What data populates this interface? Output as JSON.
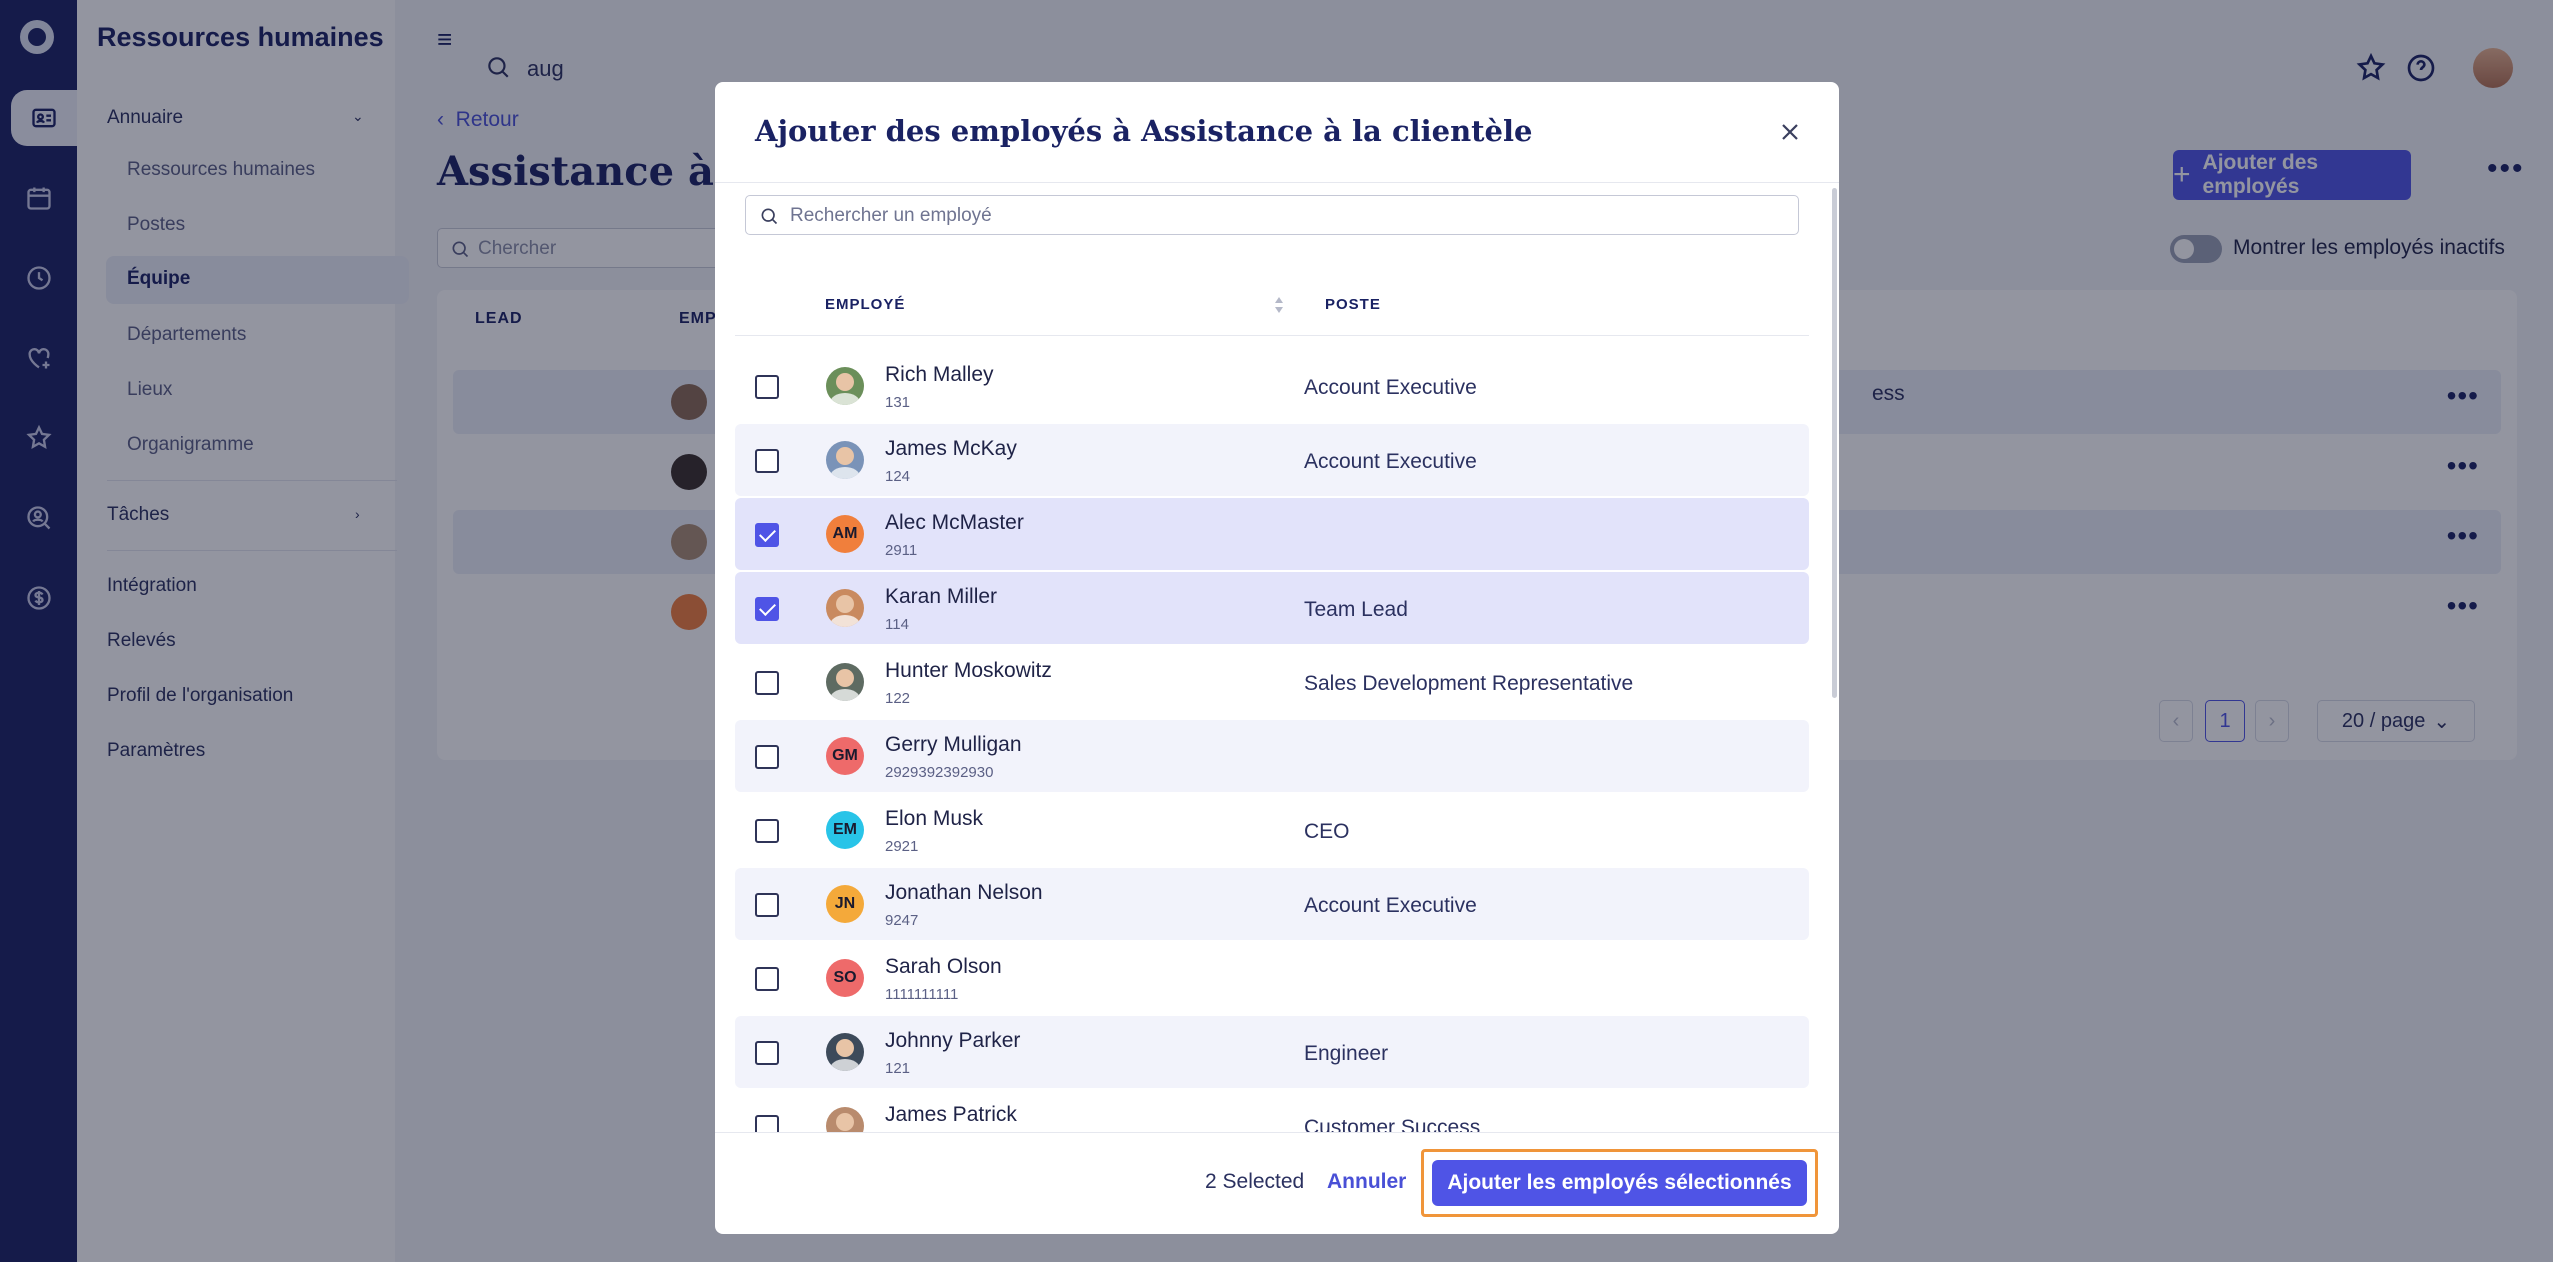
{
  "app": {
    "title": "Ressources humaines"
  },
  "rail": {
    "items": [
      {
        "icon": "contact-card-icon",
        "active": true
      },
      {
        "icon": "calendar-icon",
        "active": false
      },
      {
        "icon": "clock-icon",
        "active": false
      },
      {
        "icon": "heart-plus-icon",
        "active": false
      },
      {
        "icon": "star-plus-icon",
        "active": false
      },
      {
        "icon": "person-search-icon",
        "active": false
      },
      {
        "icon": "dollar-icon",
        "active": false
      }
    ]
  },
  "sidebar": {
    "sections": [
      {
        "label": "Annuaire"
      },
      {
        "label": "Tâches"
      },
      {
        "label": "Intégration"
      },
      {
        "label": "Relevés"
      },
      {
        "label": "Profil de l'organisation"
      },
      {
        "label": "Paramètres"
      }
    ],
    "annuaire_items": [
      {
        "label": "Ressources humaines"
      },
      {
        "label": "Postes"
      },
      {
        "label": "Équipe"
      },
      {
        "label": "Départements"
      },
      {
        "label": "Lieux"
      },
      {
        "label": "Organigramme"
      }
    ]
  },
  "header": {
    "search_value": "aug"
  },
  "page": {
    "back_label": "Retour",
    "title": "Assistance à la",
    "add_button": "Ajouter des employés",
    "search_placeholder": "Chercher",
    "toggle_label": "Montrer les employés inactifs",
    "table_headers": {
      "lead": "LEAD",
      "employee": "EMP"
    },
    "partial_cell": "ess",
    "current_page": "1",
    "page_size": "20 / page"
  },
  "modal": {
    "title": "Ajouter des employés à Assistance à la clientèle",
    "search_placeholder": "Rechercher un employé",
    "col_employee": "EMPLOYÉ",
    "col_position": "POSTE",
    "employees": [
      {
        "name": "Rich Malley",
        "id": "131",
        "position": "Account Executive",
        "checked": false,
        "initials": "",
        "avatar_color": "#6b8f5a"
      },
      {
        "name": "James McKay",
        "id": "124",
        "position": "Account Executive",
        "checked": false,
        "initials": "",
        "avatar_color": "#7a93b8"
      },
      {
        "name": "Alec McMaster",
        "id": "2911",
        "position": "",
        "checked": true,
        "initials": "AM",
        "avatar_color": "#f07f3c"
      },
      {
        "name": "Karan Miller",
        "id": "114",
        "position": "Team Lead",
        "checked": true,
        "initials": "",
        "avatar_color": "#c98a5f"
      },
      {
        "name": "Hunter Moskowitz",
        "id": "122",
        "position": "Sales Development Representative",
        "checked": false,
        "initials": "",
        "avatar_color": "#5e6b62"
      },
      {
        "name": "Gerry Mulligan",
        "id": "2929392392930",
        "position": "",
        "checked": false,
        "initials": "GM",
        "avatar_color": "#ee6a6a"
      },
      {
        "name": "Elon Musk",
        "id": "2921",
        "position": "CEO",
        "checked": false,
        "initials": "EM",
        "avatar_color": "#28c4e8"
      },
      {
        "name": "Jonathan Nelson",
        "id": "9247",
        "position": "Account Executive",
        "checked": false,
        "initials": "JN",
        "avatar_color": "#f4a93a"
      },
      {
        "name": "Sarah Olson",
        "id": "1111111111",
        "position": "",
        "checked": false,
        "initials": "SO",
        "avatar_color": "#ee6a6a"
      },
      {
        "name": "Johnny Parker",
        "id": "121",
        "position": "Engineer",
        "checked": false,
        "initials": "",
        "avatar_color": "#3d4a5a"
      },
      {
        "name": "James Patrick",
        "id": "",
        "position": "Customer Success",
        "checked": false,
        "initials": "",
        "avatar_color": "#b98b6d"
      }
    ],
    "selected_count": "2 Selected",
    "cancel_label": "Annuler",
    "confirm_label": "Ajouter les employés sélectionnés"
  },
  "colors": {
    "rail": "#1a2263",
    "accent": "#4f54e6",
    "highlight": "#f0953a",
    "selected_row": "#e2e3fa"
  }
}
